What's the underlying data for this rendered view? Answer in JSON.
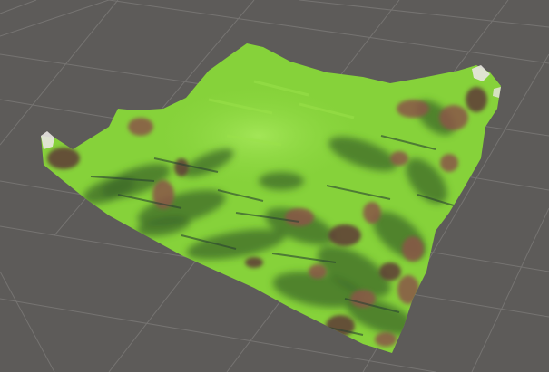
{
  "viewport": {
    "name": "scene-view",
    "background_color": "#5d5b59",
    "grid_color": "#8a8886",
    "terrain": {
      "name": "terrain-mesh",
      "colors": {
        "grass": "#86d23a",
        "grass_light": "#9be24a",
        "grass_shadow": "#3e6a2a",
        "deep_shadow": "#2a4232",
        "rock": "#8a5548",
        "rock_dark": "#5e3a35",
        "snow": "#e9e6e2"
      }
    }
  }
}
